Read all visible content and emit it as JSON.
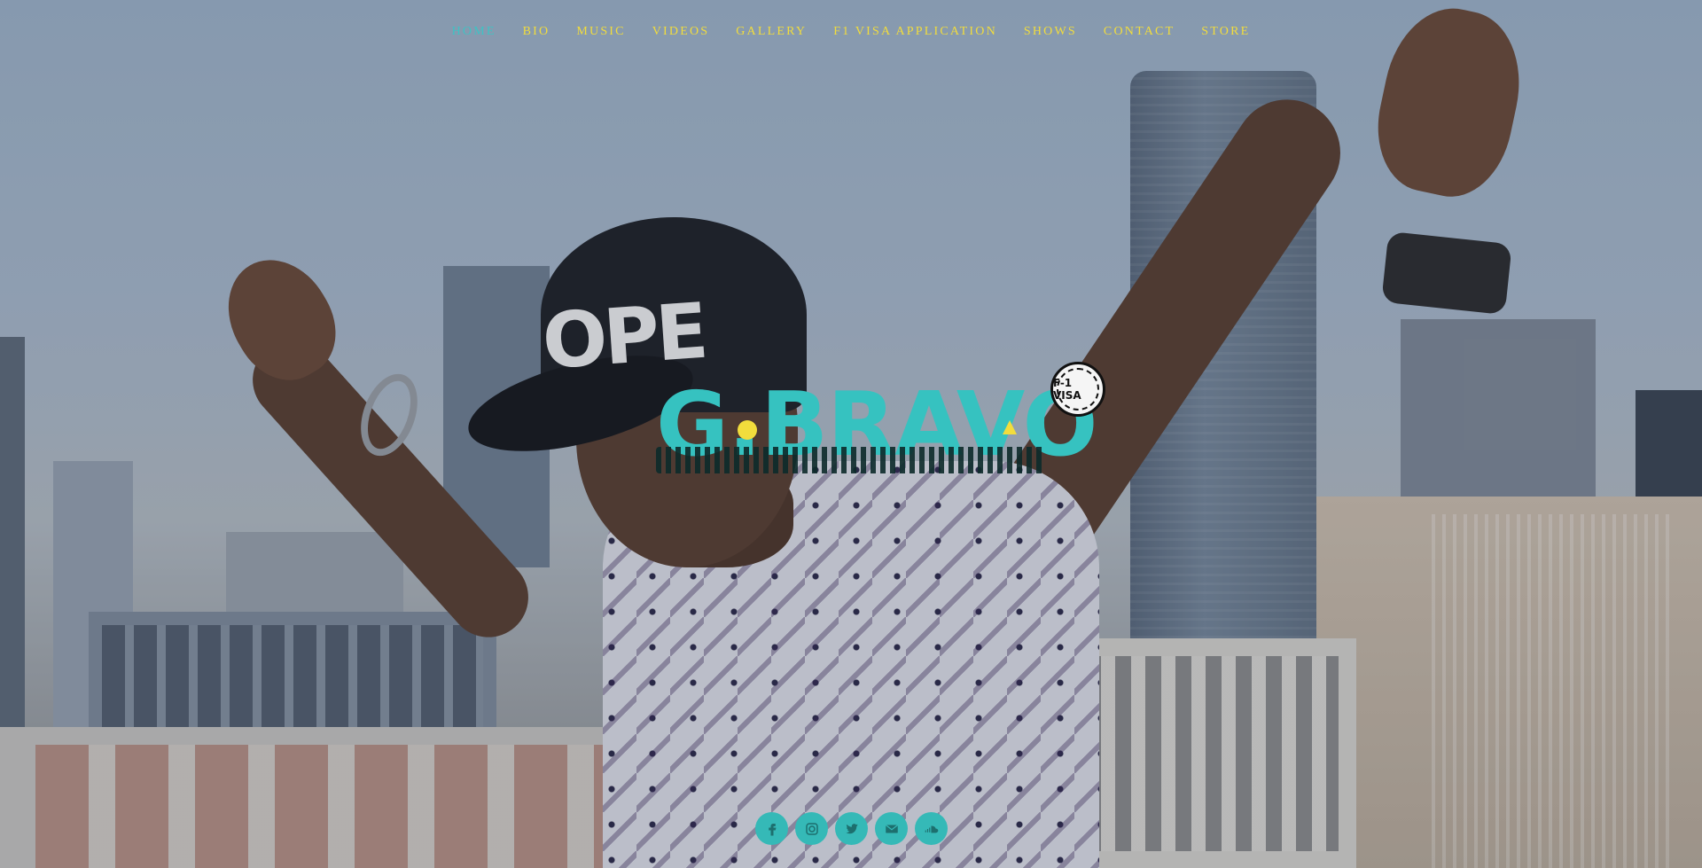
{
  "nav": {
    "items": [
      {
        "label": "HOME",
        "active": true
      },
      {
        "label": "BIO",
        "active": false
      },
      {
        "label": "MUSIC",
        "active": false
      },
      {
        "label": "VIDEOS",
        "active": false
      },
      {
        "label": "GALLERY",
        "active": false
      },
      {
        "label": "F1 VISA APPLICATION",
        "active": false
      },
      {
        "label": "SHOWS",
        "active": false
      },
      {
        "label": "CONTACT",
        "active": false
      },
      {
        "label": "STORE",
        "active": false
      }
    ],
    "color": "#f2dd3c",
    "active_color": "#3ec3c4"
  },
  "hero": {
    "cap_text": "OPE",
    "logo_text": "G.BRAVO",
    "logo_color": "#36c2c0",
    "badge_text": "F-1 VISA"
  },
  "social": {
    "icons": [
      {
        "name": "facebook-icon",
        "glyph": "f"
      },
      {
        "name": "instagram-icon",
        "glyph": "◻"
      },
      {
        "name": "twitter-icon",
        "glyph": "🐦"
      },
      {
        "name": "email-icon",
        "glyph": "✉"
      },
      {
        "name": "soundcloud-icon",
        "glyph": "☁"
      }
    ],
    "color": "#35b9b7"
  }
}
